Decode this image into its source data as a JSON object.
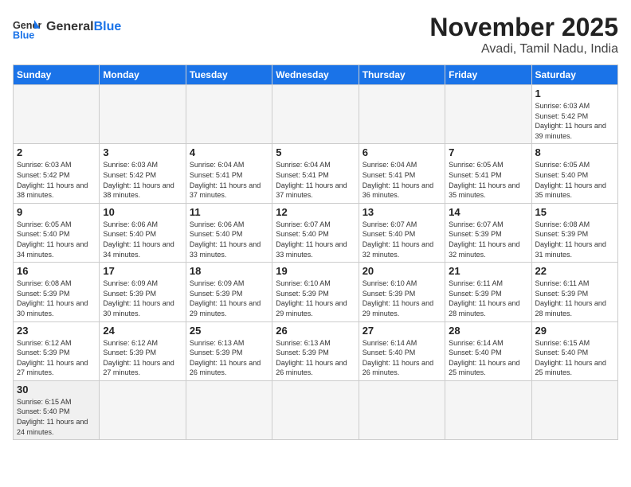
{
  "header": {
    "logo_general": "General",
    "logo_blue": "Blue",
    "month_title": "November 2025",
    "location": "Avadi, Tamil Nadu, India"
  },
  "days_of_week": [
    "Sunday",
    "Monday",
    "Tuesday",
    "Wednesday",
    "Thursday",
    "Friday",
    "Saturday"
  ],
  "weeks": [
    [
      {
        "day": "",
        "sunrise": "",
        "sunset": "",
        "daylight": ""
      },
      {
        "day": "",
        "sunrise": "",
        "sunset": "",
        "daylight": ""
      },
      {
        "day": "",
        "sunrise": "",
        "sunset": "",
        "daylight": ""
      },
      {
        "day": "",
        "sunrise": "",
        "sunset": "",
        "daylight": ""
      },
      {
        "day": "",
        "sunrise": "",
        "sunset": "",
        "daylight": ""
      },
      {
        "day": "",
        "sunrise": "",
        "sunset": "",
        "daylight": ""
      },
      {
        "day": "1",
        "sunrise": "Sunrise: 6:03 AM",
        "sunset": "Sunset: 5:42 PM",
        "daylight": "Daylight: 11 hours and 39 minutes."
      }
    ],
    [
      {
        "day": "2",
        "sunrise": "Sunrise: 6:03 AM",
        "sunset": "Sunset: 5:42 PM",
        "daylight": "Daylight: 11 hours and 38 minutes."
      },
      {
        "day": "3",
        "sunrise": "Sunrise: 6:03 AM",
        "sunset": "Sunset: 5:42 PM",
        "daylight": "Daylight: 11 hours and 38 minutes."
      },
      {
        "day": "4",
        "sunrise": "Sunrise: 6:04 AM",
        "sunset": "Sunset: 5:41 PM",
        "daylight": "Daylight: 11 hours and 37 minutes."
      },
      {
        "day": "5",
        "sunrise": "Sunrise: 6:04 AM",
        "sunset": "Sunset: 5:41 PM",
        "daylight": "Daylight: 11 hours and 37 minutes."
      },
      {
        "day": "6",
        "sunrise": "Sunrise: 6:04 AM",
        "sunset": "Sunset: 5:41 PM",
        "daylight": "Daylight: 11 hours and 36 minutes."
      },
      {
        "day": "7",
        "sunrise": "Sunrise: 6:05 AM",
        "sunset": "Sunset: 5:41 PM",
        "daylight": "Daylight: 11 hours and 35 minutes."
      },
      {
        "day": "8",
        "sunrise": "Sunrise: 6:05 AM",
        "sunset": "Sunset: 5:40 PM",
        "daylight": "Daylight: 11 hours and 35 minutes."
      }
    ],
    [
      {
        "day": "9",
        "sunrise": "Sunrise: 6:05 AM",
        "sunset": "Sunset: 5:40 PM",
        "daylight": "Daylight: 11 hours and 34 minutes."
      },
      {
        "day": "10",
        "sunrise": "Sunrise: 6:06 AM",
        "sunset": "Sunset: 5:40 PM",
        "daylight": "Daylight: 11 hours and 34 minutes."
      },
      {
        "day": "11",
        "sunrise": "Sunrise: 6:06 AM",
        "sunset": "Sunset: 5:40 PM",
        "daylight": "Daylight: 11 hours and 33 minutes."
      },
      {
        "day": "12",
        "sunrise": "Sunrise: 6:07 AM",
        "sunset": "Sunset: 5:40 PM",
        "daylight": "Daylight: 11 hours and 33 minutes."
      },
      {
        "day": "13",
        "sunrise": "Sunrise: 6:07 AM",
        "sunset": "Sunset: 5:40 PM",
        "daylight": "Daylight: 11 hours and 32 minutes."
      },
      {
        "day": "14",
        "sunrise": "Sunrise: 6:07 AM",
        "sunset": "Sunset: 5:39 PM",
        "daylight": "Daylight: 11 hours and 32 minutes."
      },
      {
        "day": "15",
        "sunrise": "Sunrise: 6:08 AM",
        "sunset": "Sunset: 5:39 PM",
        "daylight": "Daylight: 11 hours and 31 minutes."
      }
    ],
    [
      {
        "day": "16",
        "sunrise": "Sunrise: 6:08 AM",
        "sunset": "Sunset: 5:39 PM",
        "daylight": "Daylight: 11 hours and 30 minutes."
      },
      {
        "day": "17",
        "sunrise": "Sunrise: 6:09 AM",
        "sunset": "Sunset: 5:39 PM",
        "daylight": "Daylight: 11 hours and 30 minutes."
      },
      {
        "day": "18",
        "sunrise": "Sunrise: 6:09 AM",
        "sunset": "Sunset: 5:39 PM",
        "daylight": "Daylight: 11 hours and 29 minutes."
      },
      {
        "day": "19",
        "sunrise": "Sunrise: 6:10 AM",
        "sunset": "Sunset: 5:39 PM",
        "daylight": "Daylight: 11 hours and 29 minutes."
      },
      {
        "day": "20",
        "sunrise": "Sunrise: 6:10 AM",
        "sunset": "Sunset: 5:39 PM",
        "daylight": "Daylight: 11 hours and 29 minutes."
      },
      {
        "day": "21",
        "sunrise": "Sunrise: 6:11 AM",
        "sunset": "Sunset: 5:39 PM",
        "daylight": "Daylight: 11 hours and 28 minutes."
      },
      {
        "day": "22",
        "sunrise": "Sunrise: 6:11 AM",
        "sunset": "Sunset: 5:39 PM",
        "daylight": "Daylight: 11 hours and 28 minutes."
      }
    ],
    [
      {
        "day": "23",
        "sunrise": "Sunrise: 6:12 AM",
        "sunset": "Sunset: 5:39 PM",
        "daylight": "Daylight: 11 hours and 27 minutes."
      },
      {
        "day": "24",
        "sunrise": "Sunrise: 6:12 AM",
        "sunset": "Sunset: 5:39 PM",
        "daylight": "Daylight: 11 hours and 27 minutes."
      },
      {
        "day": "25",
        "sunrise": "Sunrise: 6:13 AM",
        "sunset": "Sunset: 5:39 PM",
        "daylight": "Daylight: 11 hours and 26 minutes."
      },
      {
        "day": "26",
        "sunrise": "Sunrise: 6:13 AM",
        "sunset": "Sunset: 5:39 PM",
        "daylight": "Daylight: 11 hours and 26 minutes."
      },
      {
        "day": "27",
        "sunrise": "Sunrise: 6:14 AM",
        "sunset": "Sunset: 5:40 PM",
        "daylight": "Daylight: 11 hours and 26 minutes."
      },
      {
        "day": "28",
        "sunrise": "Sunrise: 6:14 AM",
        "sunset": "Sunset: 5:40 PM",
        "daylight": "Daylight: 11 hours and 25 minutes."
      },
      {
        "day": "29",
        "sunrise": "Sunrise: 6:15 AM",
        "sunset": "Sunset: 5:40 PM",
        "daylight": "Daylight: 11 hours and 25 minutes."
      }
    ],
    [
      {
        "day": "30",
        "sunrise": "Sunrise: 6:15 AM",
        "sunset": "Sunset: 5:40 PM",
        "daylight": "Daylight: 11 hours and 24 minutes."
      },
      {
        "day": "",
        "sunrise": "",
        "sunset": "",
        "daylight": ""
      },
      {
        "day": "",
        "sunrise": "",
        "sunset": "",
        "daylight": ""
      },
      {
        "day": "",
        "sunrise": "",
        "sunset": "",
        "daylight": ""
      },
      {
        "day": "",
        "sunrise": "",
        "sunset": "",
        "daylight": ""
      },
      {
        "day": "",
        "sunrise": "",
        "sunset": "",
        "daylight": ""
      },
      {
        "day": "",
        "sunrise": "",
        "sunset": "",
        "daylight": ""
      }
    ]
  ]
}
